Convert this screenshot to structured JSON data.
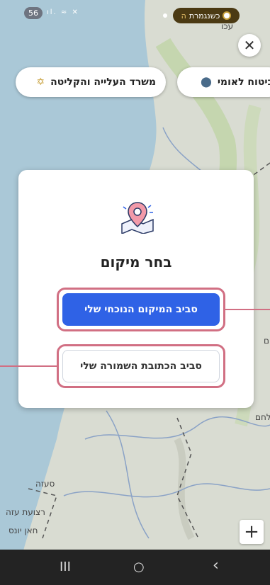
{
  "status_bar": {
    "badge": "56",
    "signal_icons": "ıl. ≈ ✕",
    "notification_pill": {
      "label": "כשנגמרת",
      "suffix": "ה"
    }
  },
  "close_button": {
    "glyph": "✕"
  },
  "quick_chips": [
    {
      "label": "משרד העלייה והקליטה",
      "icon": "star-of-david-icon",
      "glyph": "✡"
    },
    {
      "label": "ביטוח לאומי",
      "icon": "national-insurance-icon",
      "glyph": "⬤"
    }
  ],
  "dialog": {
    "title": "בחר מיקום",
    "primary_button": "סביב המיקום הנוכחי שלי",
    "secondary_button": "סביב הכתובת השמורה שלי"
  },
  "map_labels": {
    "akko": "עכו",
    "seaza": "סעזה",
    "rtzoat_aza": "רצועת עזה",
    "khan_yunis": "חאן יונס",
    "lehem": "לחם",
    "ramla": "ם"
  },
  "zoom_button": "+",
  "nav_bar": {
    "recent": "III",
    "home": "○",
    "back": "‹"
  },
  "colors": {
    "primary": "#2f62e6",
    "highlight": "#d16f83",
    "sea": "#aac8d7",
    "land": "#d9dcd2"
  }
}
